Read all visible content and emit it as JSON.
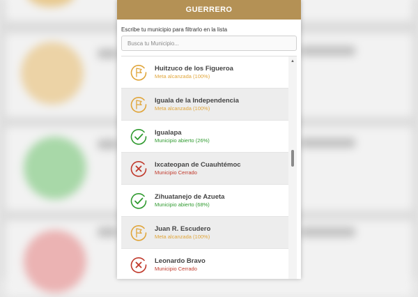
{
  "modal": {
    "title": "GUERRERO",
    "filter_label": "Escribe tu municipio para filtrarlo en la lista",
    "search_placeholder": "Busca tu Municipio..."
  },
  "colors": {
    "header": "#b49155",
    "goal": "#e0a53a",
    "open": "#2f9a2f",
    "closed": "#c0392b"
  },
  "municipios": [
    {
      "name": "Huitzuco de los Figueroa",
      "status": "Meta alcanzada (100%)",
      "kind": "goal",
      "icon": "flag-icon"
    },
    {
      "name": "Iguala de la Independencia",
      "status": "Meta alcanzada (100%)",
      "kind": "goal",
      "icon": "flag-icon"
    },
    {
      "name": "Igualapa",
      "status": "Municipio abierto (26%)",
      "kind": "open",
      "icon": "check-icon"
    },
    {
      "name": "Ixcateopan de Cuauhtémoc",
      "status": "Municipio Cerrado",
      "kind": "closed",
      "icon": "x-icon"
    },
    {
      "name": "Zihuatanejo de Azueta",
      "status": "Municipio abierto (68%)",
      "kind": "open",
      "icon": "check-icon"
    },
    {
      "name": "Juan R. Escudero",
      "status": "Meta alcanzada (100%)",
      "kind": "goal",
      "icon": "flag-icon"
    },
    {
      "name": "Leonardo Bravo",
      "status": "Municipio Cerrado",
      "kind": "closed",
      "icon": "x-icon"
    }
  ]
}
